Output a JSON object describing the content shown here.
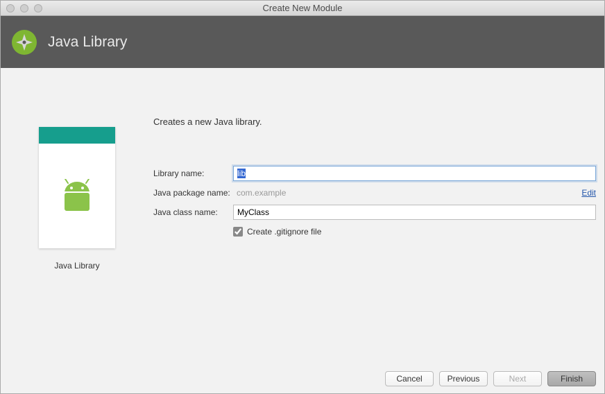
{
  "window": {
    "title": "Create New Module"
  },
  "header": {
    "title": "Java Library"
  },
  "sidebar": {
    "card_label": "Java Library"
  },
  "form": {
    "description": "Creates a new Java library.",
    "library_name_label": "Library name:",
    "library_name_value": "lib",
    "package_name_label": "Java package name:",
    "package_name_value": "com.example",
    "package_edit_label": "Edit",
    "class_name_label": "Java class name:",
    "class_name_value": "MyClass",
    "gitignore_label": "Create .gitignore file",
    "gitignore_checked": true
  },
  "footer": {
    "cancel": "Cancel",
    "previous": "Previous",
    "next": "Next",
    "finish": "Finish"
  }
}
